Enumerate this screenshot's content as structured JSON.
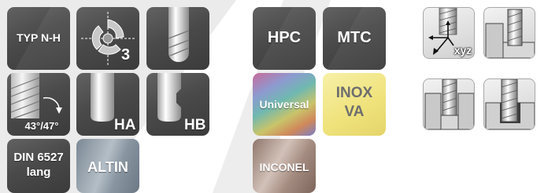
{
  "colors": {
    "tile_dark": "#4a4a4a",
    "tile_text": "#ffffff",
    "inox_bg": "#f3e98c",
    "inox_text": "#6e6e6e",
    "altin_bg": "#8a99a6",
    "inconel_bg": "#a58c83",
    "background_shape": "#ebebeb"
  },
  "tiles": {
    "typ_nh": {
      "label": "TYP N-H"
    },
    "cutter_3": {
      "icon": "end-mill-cross-section-icon",
      "count": "3"
    },
    "shank_plain": {
      "icon": "cylindrical-shank-icon"
    },
    "helix": {
      "icon": "helix-angle-icon",
      "label": "43°/47°"
    },
    "ha": {
      "icon": "shank-ha-icon",
      "label": "HA"
    },
    "hb": {
      "icon": "shank-hb-icon",
      "label": "HB"
    },
    "din": {
      "line1": "DIN 6527",
      "line2": "lang"
    },
    "altin": {
      "label": "ALTIN"
    },
    "hpc": {
      "label": "HPC"
    },
    "mtc": {
      "label": "MTC"
    },
    "universal": {
      "label": "Universal"
    },
    "inox": {
      "line1": "INOX",
      "line2": "VA"
    },
    "inconel": {
      "label": "INCONEL"
    }
  },
  "applications": {
    "xyz": {
      "icon": "xyz-axes-milling-icon",
      "label": "xyz"
    },
    "shoulder": {
      "icon": "shoulder-milling-icon"
    },
    "slot": {
      "icon": "slot-milling-icon"
    },
    "plunge": {
      "icon": "plunge-milling-icon"
    }
  }
}
